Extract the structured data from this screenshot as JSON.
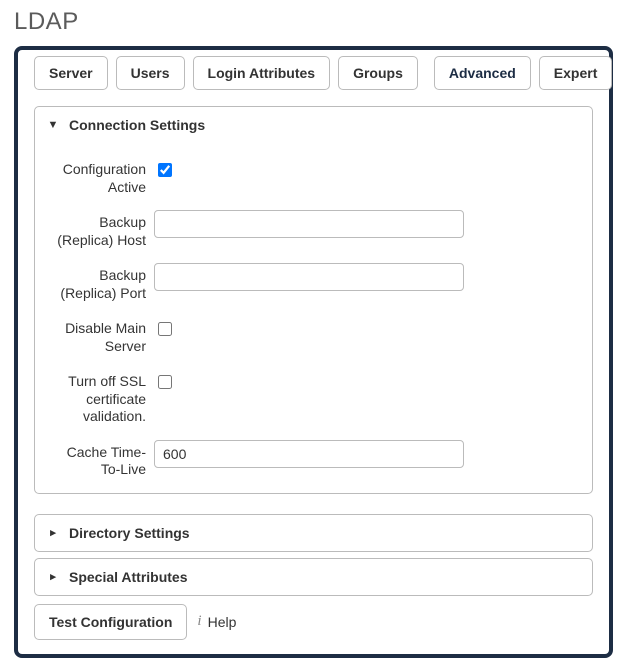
{
  "page_title": "LDAP",
  "tabs": {
    "server": "Server",
    "users": "Users",
    "login_attributes": "Login Attributes",
    "groups": "Groups",
    "advanced": "Advanced",
    "expert": "Expert",
    "active": "advanced"
  },
  "sections": {
    "connection": {
      "title": "Connection Settings",
      "expanded": true,
      "fields": {
        "config_active": {
          "label": "Configuration Active",
          "checked": true
        },
        "backup_host": {
          "label": "Backup (Replica) Host",
          "value": ""
        },
        "backup_port": {
          "label": "Backup (Replica) Port",
          "value": ""
        },
        "disable_main": {
          "label": "Disable Main Server",
          "checked": false
        },
        "turn_off_ssl": {
          "label": "Turn off SSL certificate validation.",
          "checked": false
        },
        "cache_ttl": {
          "label": "Cache Time-To-Live",
          "value": "600"
        }
      }
    },
    "directory": {
      "title": "Directory Settings",
      "expanded": false
    },
    "special": {
      "title": "Special Attributes",
      "expanded": false
    }
  },
  "actions": {
    "test_configuration": "Test Configuration",
    "help": "Help"
  },
  "icons": {
    "triangle_down": "▼",
    "triangle_right": "▸",
    "info": "i"
  }
}
